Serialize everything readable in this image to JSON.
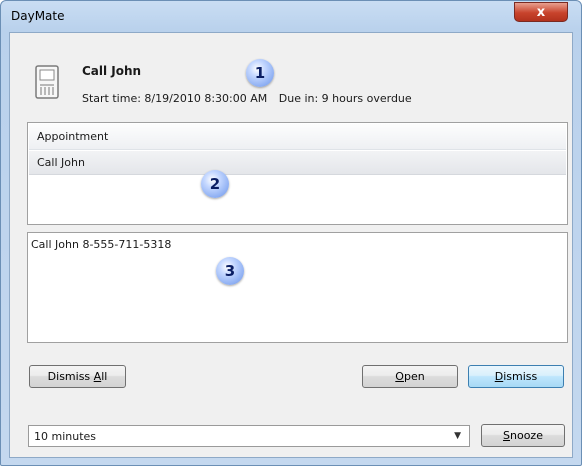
{
  "window": {
    "title": "DayMate",
    "close_glyph": "x"
  },
  "reminder": {
    "subject": "Call John",
    "start_time": "Start time: 8/19/2010 8:30:00 AM",
    "due": "Due in: 9 hours overdue",
    "icon": "reminder-icon"
  },
  "list": {
    "header": "Appointment",
    "items": [
      "Call John"
    ]
  },
  "notes": "Call John 8-555-711-5318",
  "buttons": {
    "dismiss_all_pre": "Dismiss ",
    "dismiss_all_key": "A",
    "dismiss_all_post": "ll",
    "open_key": "O",
    "open_post": "pen",
    "dismiss_key": "D",
    "dismiss_post": "ismiss",
    "snooze_key": "S",
    "snooze_post": "nooze"
  },
  "snooze": {
    "selected": "10 minutes",
    "arrow": "▼"
  },
  "callouts": [
    "1",
    "2",
    "3"
  ],
  "colors": {
    "callout": "#8fb0f3",
    "close": "#c8432c",
    "default_button": "#bee6fd"
  }
}
